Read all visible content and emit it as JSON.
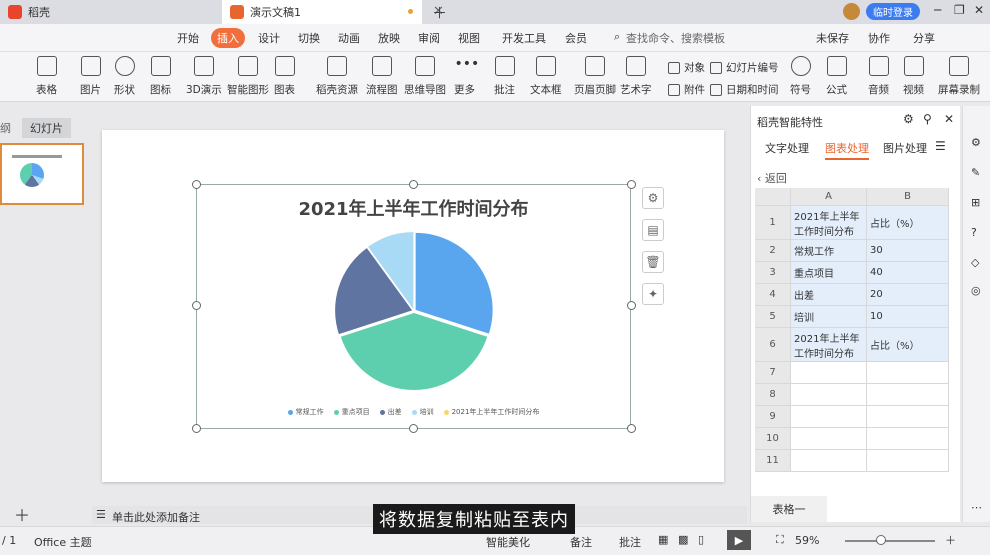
{
  "tabs": {
    "tab1": "稻壳",
    "tab2": "演示文稿1"
  },
  "titlebar": {
    "login": "临时登录"
  },
  "menu": [
    "开始",
    "插入",
    "设计",
    "切换",
    "动画",
    "放映",
    "审阅",
    "视图",
    "开发工具",
    "会员"
  ],
  "menu_active": "插入",
  "search_placeholder": "查找命令、搜索模板",
  "toolbar_right": {
    "unsaved": "未保存",
    "collab": "协作",
    "share": "分享"
  },
  "ribbon": {
    "big": [
      "表格",
      "图片",
      "形状",
      "图标",
      "3D演示",
      "智能图形",
      "图表",
      "稻壳资源",
      "流程图",
      "思维导图",
      "更多",
      "批注",
      "文本框",
      "页眉页脚",
      "艺术字",
      "符号",
      "公式",
      "音频",
      "视频",
      "屏幕录制"
    ],
    "small": {
      "object": "对象",
      "slide_num": "幻灯片编号",
      "attach": "附件",
      "datetime": "日期和时间"
    }
  },
  "left": {
    "outline": "纲",
    "slides": "幻灯片",
    "slide_index": "1"
  },
  "chart": {
    "title": "2021年上半年工作时间分布"
  },
  "chart_data": {
    "type": "pie",
    "title": "2021年上半年工作时间分布",
    "categories": [
      "常规工作",
      "重点项目",
      "出差",
      "培训",
      "2021年上半年工作时间分布"
    ],
    "values": [
      30,
      40,
      20,
      10,
      0
    ],
    "colors": [
      "#5aa6ee",
      "#5ecfae",
      "#5f74a0",
      "#a8daf6",
      "#f5d66b"
    ],
    "legend": "bottom"
  },
  "panel": {
    "title": "稻壳智能特性",
    "tabs": [
      "文字处理",
      "图表处理",
      "图片处理"
    ],
    "active_tab": "图表处理",
    "back": "返回",
    "columns": [
      "A",
      "B"
    ],
    "rows": [
      {
        "n": "1",
        "a": "2021年上半年工作时间分布",
        "b": "占比（%）"
      },
      {
        "n": "2",
        "a": "常规工作",
        "b": "30"
      },
      {
        "n": "3",
        "a": "重点项目",
        "b": "40"
      },
      {
        "n": "4",
        "a": "出差",
        "b": "20"
      },
      {
        "n": "5",
        "a": "培训",
        "b": "10"
      },
      {
        "n": "6",
        "a": "2021年上半年工作时间分布",
        "b": "占比（%）"
      },
      {
        "n": "7",
        "a": "",
        "b": ""
      },
      {
        "n": "8",
        "a": "",
        "b": ""
      },
      {
        "n": "9",
        "a": "",
        "b": ""
      },
      {
        "n": "10",
        "a": "",
        "b": ""
      },
      {
        "n": "11",
        "a": "",
        "b": ""
      }
    ],
    "sheet": "表格一"
  },
  "notes": {
    "placeholder": "单击此处添加备注"
  },
  "status": {
    "page": "/ 1",
    "theme": "Office 主题",
    "beautify": "智能美化",
    "notes": "备注",
    "comment": "批注",
    "zoom": "59%"
  },
  "subtitle": "将数据复制粘贴至表内"
}
